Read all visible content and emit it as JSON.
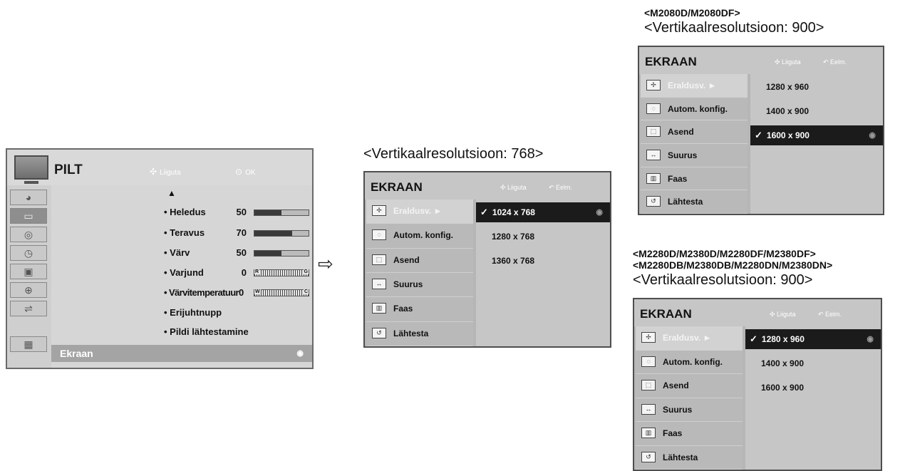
{
  "pilt_menu": {
    "title": "PILT",
    "hint_move": "Liiguta",
    "hint_ok": "OK",
    "scroll_up": "▲",
    "items": [
      {
        "label": "• Heledus",
        "value": "50",
        "bar": "level",
        "level": 0.5
      },
      {
        "label": "• Teravus",
        "value": "70",
        "bar": "level",
        "level": 0.7
      },
      {
        "label": "• Värv",
        "value": "50",
        "bar": "level",
        "level": 0.5
      },
      {
        "label": "• Varjund",
        "value": "0",
        "bar": "comb",
        "left_mark": "R",
        "right_mark": "G"
      },
      {
        "label": "• Värvitemperatuur",
        "value": "0",
        "bar": "comb",
        "left_mark": "W",
        "right_mark": "C"
      },
      {
        "label": "• Erijuhtnupp"
      },
      {
        "label": "• Pildi lähtestamine"
      }
    ],
    "highlighted": "Ekraan"
  },
  "panels": [
    {
      "header_lines": [
        "<Vertikaalresolutsioon: 768>"
      ],
      "title": "EKRAAN",
      "hint_move": "Liiguta",
      "hint_prev": "Eelm.",
      "menu": [
        {
          "label": "Eraldusv. ►",
          "active": true
        },
        {
          "label": "Autom. konfig."
        },
        {
          "label": "Asend"
        },
        {
          "label": "Suurus"
        },
        {
          "label": "Faas"
        },
        {
          "label": "Lähtesta"
        }
      ],
      "options": [
        "1024 x 768",
        "1280 x 768",
        "1360 x 768"
      ],
      "selected": "1024 x 768"
    },
    {
      "header_lines": [
        "<M2080D/M2080DF>",
        "<Vertikaalresolutsioon: 900>"
      ],
      "title": "EKRAAN",
      "hint_move": "Liiguta",
      "hint_prev": "Eelm.",
      "menu": [
        {
          "label": "Eraldusv. ►",
          "active": true
        },
        {
          "label": "Autom. konfig."
        },
        {
          "label": "Asend"
        },
        {
          "label": "Suurus"
        },
        {
          "label": "Faas"
        },
        {
          "label": "Lähtesta"
        }
      ],
      "options": [
        "1280 x 960",
        "1400 x 900",
        "1600 x 900"
      ],
      "selected": "1600 x 900"
    },
    {
      "header_lines": [
        "<M2280D/M2380D/M2280DF/M2380DF>",
        "<M2280DB/M2380DB/M2280DN/M2380DN>",
        "<Vertikaalresolutsioon: 900>"
      ],
      "title": "EKRAAN",
      "hint_move": "Liiguta",
      "hint_prev": "Eelm.",
      "menu": [
        {
          "label": "Eraldusv. ►",
          "active": true
        },
        {
          "label": "Autom. konfig."
        },
        {
          "label": "Asend"
        },
        {
          "label": "Suurus"
        },
        {
          "label": "Faas"
        },
        {
          "label": "Lähtesta"
        }
      ],
      "options": [
        "1280 x 960",
        "1400 x 900",
        "1600 x 900"
      ],
      "selected": "1280 x 960"
    }
  ],
  "icons": {
    "menu_icons": [
      "resolution-icon",
      "auto-config-icon",
      "position-icon",
      "size-icon",
      "phase-icon",
      "reset-icon"
    ],
    "menu_glyphs": [
      "✢",
      "◌",
      "⬚",
      "↔",
      "▥",
      "↺"
    ],
    "arrow": "⇨"
  }
}
